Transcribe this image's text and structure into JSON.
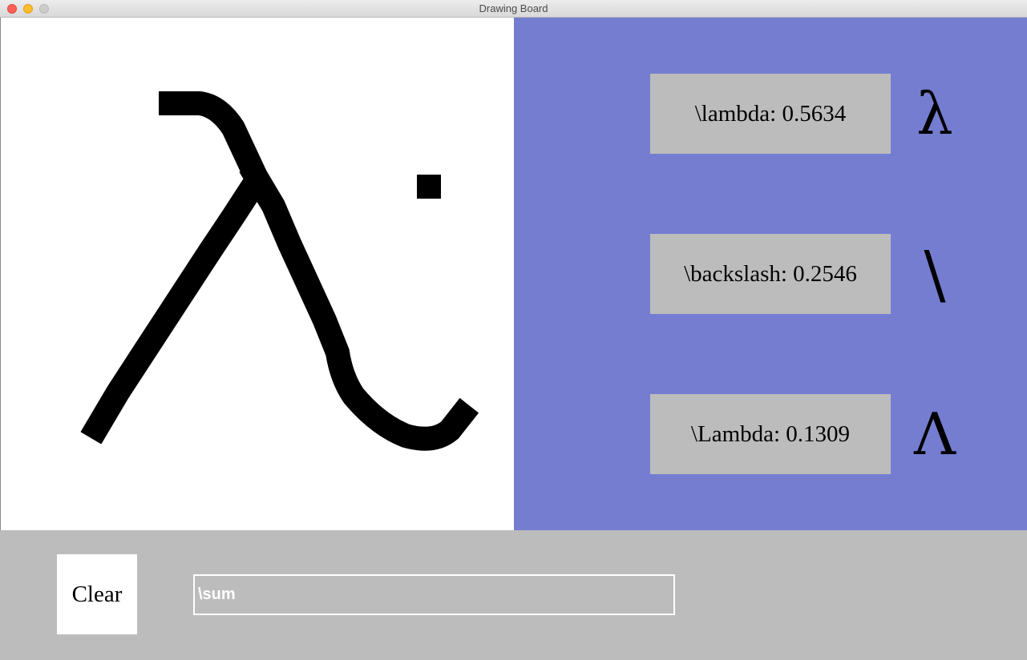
{
  "window": {
    "title": "Drawing Board"
  },
  "canvas": {
    "stroke_color": "#000000",
    "background": "#ffffff"
  },
  "predictions": {
    "panel_color": "#757dd1",
    "items": [
      {
        "label": "\\lambda: 0.5634",
        "glyph": "λ",
        "glyph_icon": "lambda-icon"
      },
      {
        "label": "\\backslash: 0.2546",
        "glyph": "\\",
        "glyph_icon": "backslash-icon"
      },
      {
        "label": "\\Lambda: 0.1309",
        "glyph": "Λ",
        "glyph_icon": "capital-lambda-icon"
      }
    ]
  },
  "controls": {
    "clear_label": "Clear",
    "input_value": "\\sum"
  }
}
